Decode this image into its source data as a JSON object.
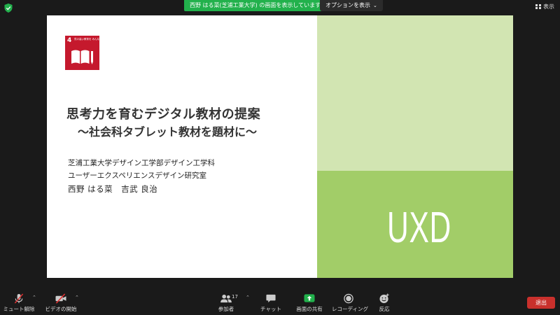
{
  "top_bar": {
    "share_banner": "西野 はる菜(芝浦工業大学) の画面を表示しています",
    "options_label": "オプションを表示",
    "view_label": "表示",
    "icons": {
      "security": "shield-icon",
      "options": "chevron-down-icon",
      "view": "grid-icon"
    }
  },
  "slide": {
    "title_line1": "思考力を育むデジタル教材の提案",
    "title_line2": "〜社会科タブレット教材を題材に〜",
    "affiliation_line1": "芝浦工業大学デザイン工学部デザイン工学科",
    "affiliation_line2": "ユーザーエクスペリエンスデザイン研究室",
    "authors": "西野 はる菜　吉武 良治",
    "sdg": {
      "number": "4",
      "text": "質の高い教育を みんなに",
      "color": "#c5192d"
    },
    "logo_text": "UXD",
    "colors": {
      "light_green": "#d2e5b2",
      "green": "#a2cd68"
    }
  },
  "toolbar": {
    "mute_label": "ミュート解除",
    "video_label": "ビデオの開始",
    "participants_label": "参加者",
    "participants_count": "17",
    "chat_label": "チャット",
    "share_label": "画面の共有",
    "record_label": "レコーディング",
    "reactions_label": "反応",
    "leave_label": "退出",
    "colors": {
      "share_green": "#22b14c",
      "leave_red": "#c9302c"
    }
  }
}
